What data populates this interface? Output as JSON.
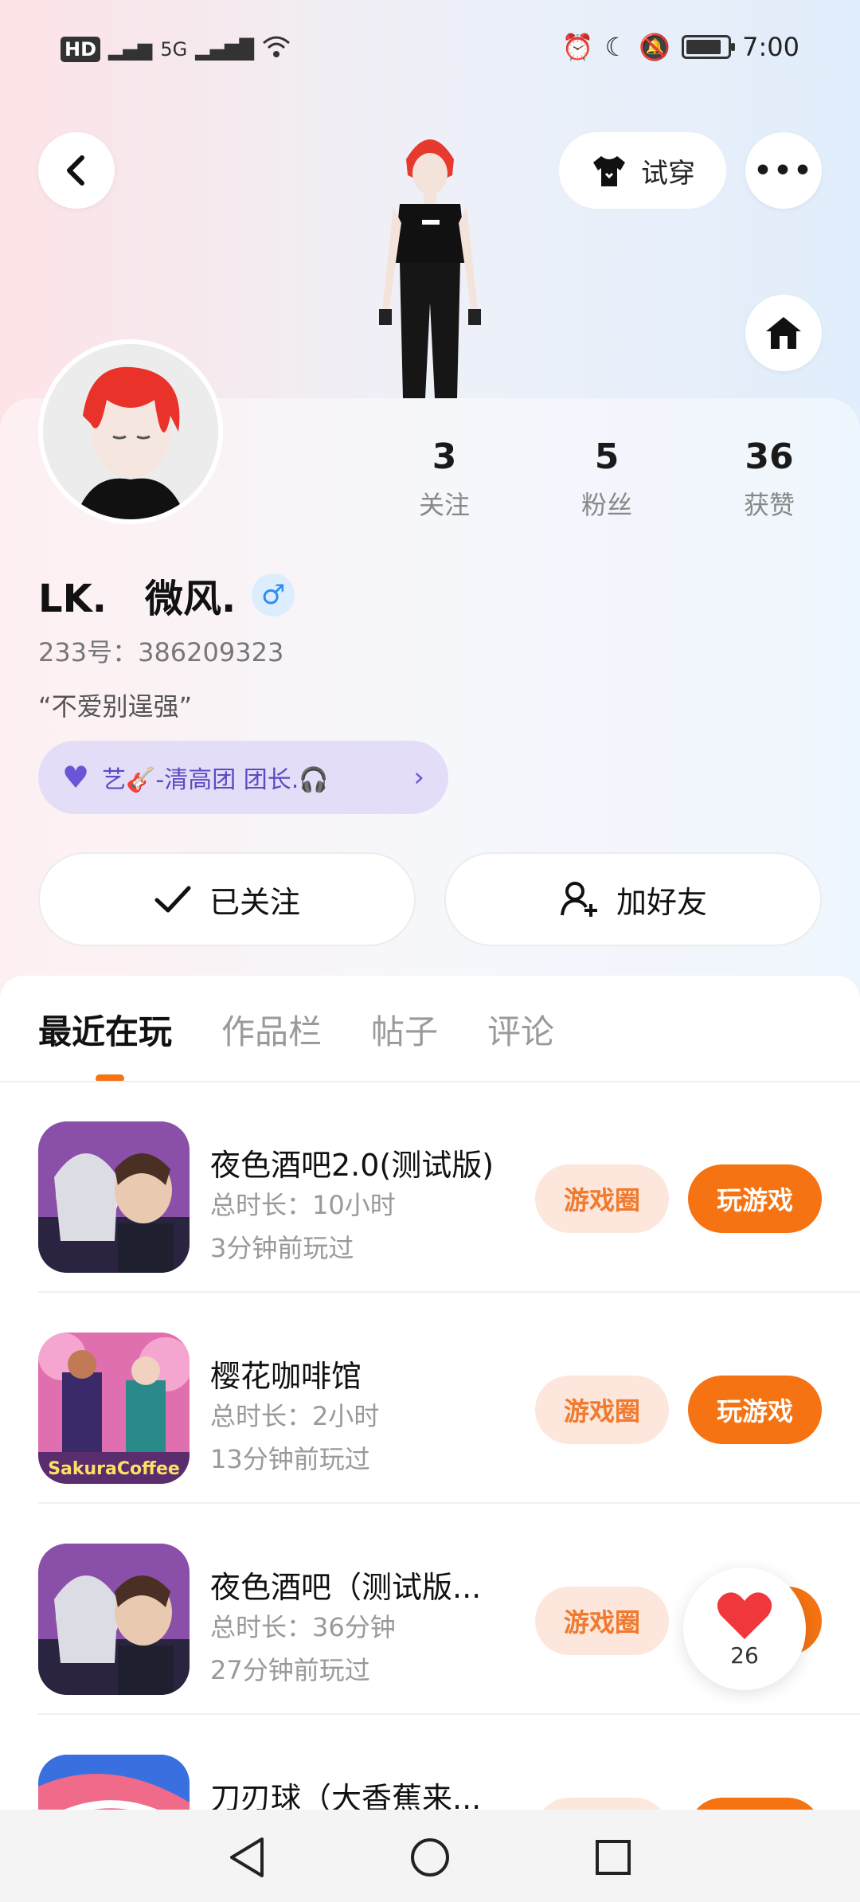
{
  "status_bar": {
    "network": "HD",
    "network_sub": "2",
    "signal_label": "5G",
    "time": "7:00",
    "battery_fraction": 0.85
  },
  "header": {
    "tryon_label": "试穿",
    "more_label": "•••"
  },
  "profile": {
    "stats": [
      {
        "value": "3",
        "label": "关注"
      },
      {
        "value": "5",
        "label": "粉丝"
      },
      {
        "value": "36",
        "label": "获赞"
      }
    ],
    "name": "LK.　微风.",
    "gender_symbol": "♂",
    "uid": "233号：386209323",
    "bio": "“不爱别逞强”",
    "group_label": "艺🎸-清高团 团长.🎧",
    "follow_label": "已关注",
    "add_friend_label": "加好友"
  },
  "tabs": [
    {
      "label": "最近在玩",
      "active": true
    },
    {
      "label": "作品栏",
      "active": false
    },
    {
      "label": "帖子",
      "active": false
    },
    {
      "label": "评论",
      "active": false
    }
  ],
  "games": [
    {
      "title": "夜色酒吧2.0(测试版)",
      "duration": "总时长：10小时",
      "last_played": "3分钟前玩过",
      "circle_label": "游戏圈",
      "play_label": "玩游戏"
    },
    {
      "title": "樱花咖啡馆",
      "duration": "总时长：2小时",
      "last_played": "13分钟前玩过",
      "circle_label": "游戏圈",
      "play_label": "玩游戏"
    },
    {
      "title": "夜色酒吧（测试版...",
      "duration": "总时长：36分钟",
      "last_played": "27分钟前玩过",
      "circle_label": "游戏圈",
      "play_label": "玩游戏"
    },
    {
      "title": "刀刃球（大香蕉来...",
      "duration": "",
      "last_played": "",
      "circle_label": "",
      "play_label": ""
    }
  ],
  "sakura_logo_text": "SakuraCoffee",
  "floating_like": {
    "count": "26"
  },
  "colors": {
    "accent": "#f57312",
    "accent_light": "#fde7dc",
    "group_bg": "#e4ddf8",
    "gender": "#2e8ef0"
  }
}
